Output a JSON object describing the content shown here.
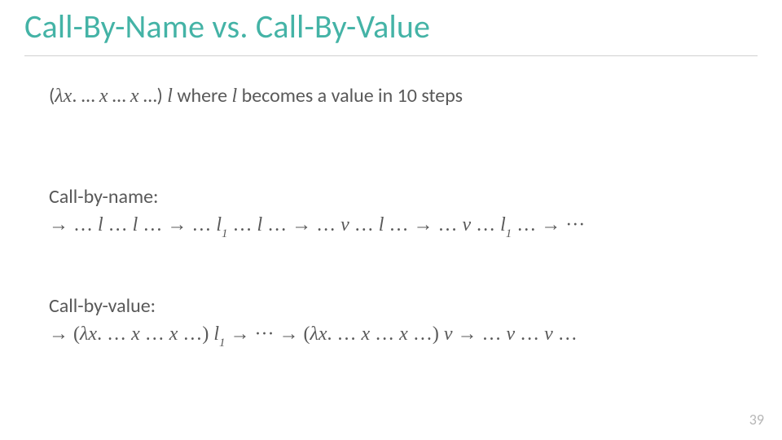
{
  "title": "Call-By-Name vs. Call-By-Value",
  "intro": {
    "expr_open": "(",
    "lambda": "λx",
    "dot": ". ",
    "d1": "… ",
    "x1": "x",
    "d2": " … ",
    "x2": "x",
    "d3": " …",
    "expr_close": ") ",
    "argL": "l",
    "where_txt": " where ",
    "argL2": "l",
    "rest": " becomes a value in 10 steps"
  },
  "cbn": {
    "label": "Call-by-name:",
    "seq": "→  … l … l … →  … l₁ … l … →  … v … l … →  … v … l₁ … → ···"
  },
  "cbv": {
    "label": "Call-by-value:",
    "seq": "→ (λx. … x … x …) l₁ → ··· → (λx. … x … x …) v →  … v … v …"
  },
  "page": "39"
}
